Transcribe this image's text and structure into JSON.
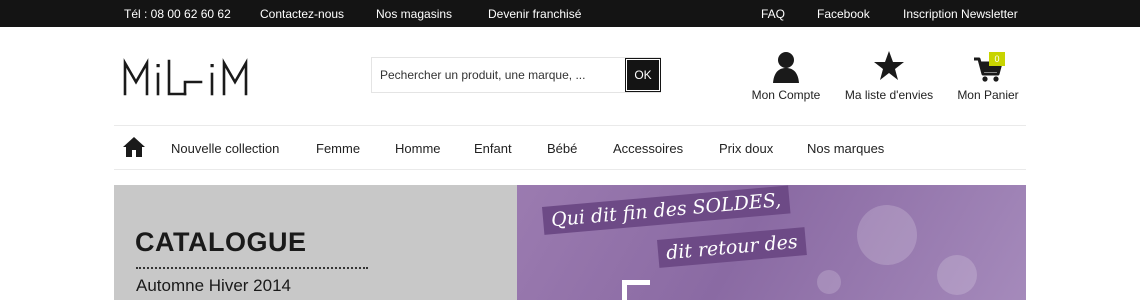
{
  "topbar": {
    "phone": "Tél : 08 00 62 60 62",
    "links_left": [
      "Contactez-nous",
      "Nos magasins",
      "Devenir franchisé"
    ],
    "links_right": [
      "FAQ",
      "Facebook",
      "Inscription Newsletter"
    ]
  },
  "brand": {
    "logo_text": "MILLIM"
  },
  "search": {
    "placeholder": "Pechercher un produit, une marque, ...",
    "button": "OK"
  },
  "header_icons": {
    "account": {
      "label": "Mon Compte",
      "icon": "user-icon"
    },
    "wishlist": {
      "label": "Ma liste d'envies",
      "icon": "star-icon"
    },
    "cart": {
      "label": "Mon Panier",
      "icon": "cart-icon",
      "count": "0"
    }
  },
  "nav": {
    "home_icon": "home-icon",
    "items": [
      "Nouvelle collection",
      "Femme",
      "Homme",
      "Enfant",
      "Bébé",
      "Accessoires",
      "Prix doux",
      "Nos marques"
    ]
  },
  "banner": {
    "title": "CATALOGUE",
    "subtitle": "Automne Hiver 2014",
    "slogan_line1": "Qui dit fin des SOLDES,",
    "slogan_line2": "dit retour des"
  },
  "colors": {
    "topbar": "#141414",
    "badge": "#c8d400",
    "banner_purple": "#8a6aa3",
    "banner_grey": "#c8c8c8"
  }
}
